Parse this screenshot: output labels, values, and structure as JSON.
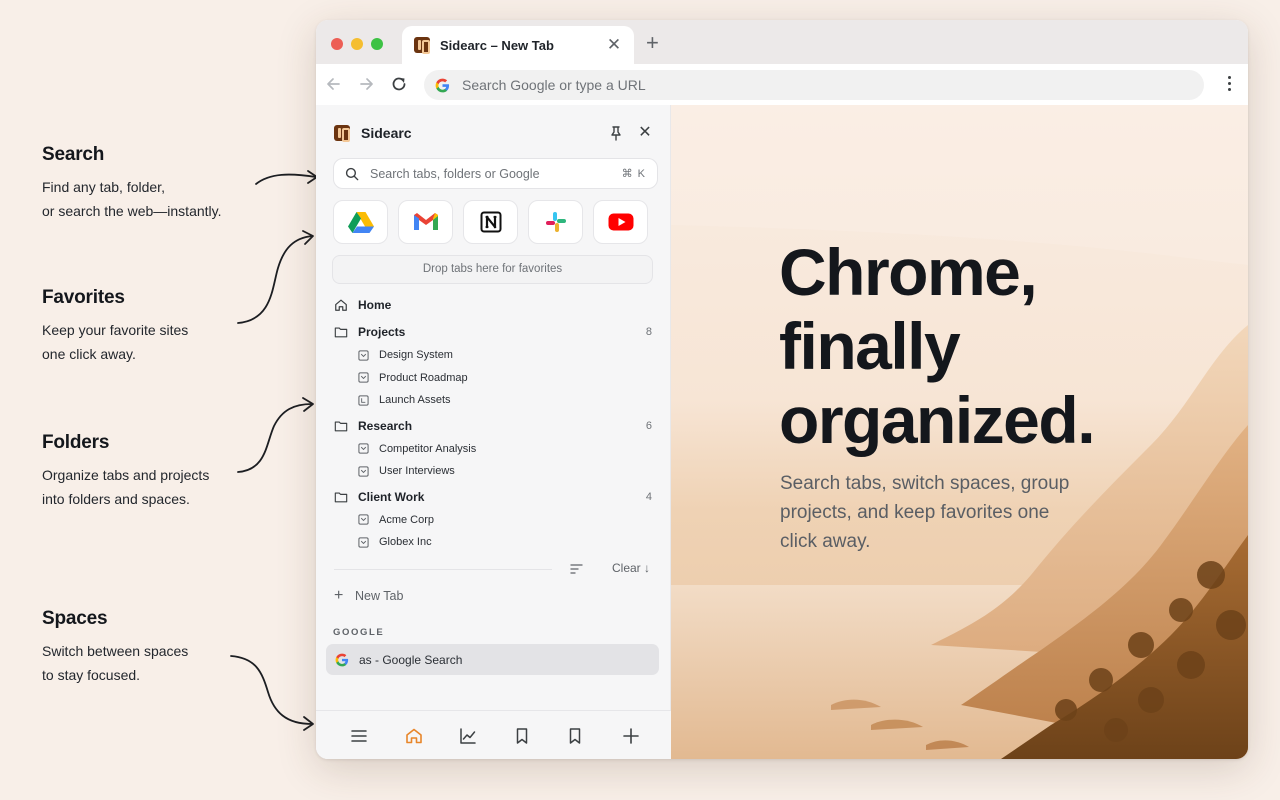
{
  "annotations": [
    {
      "title": "Search",
      "line1": "Find any tab, folder,",
      "line2": "or search the web—instantly."
    },
    {
      "title": "Favorites",
      "line1": "Keep your favorite sites",
      "line2": "one click away."
    },
    {
      "title": "Folders",
      "line1": "Organize tabs and projects",
      "line2": "into folders and spaces."
    },
    {
      "title": "Spaces",
      "line1": "Switch between spaces",
      "line2": "to stay focused."
    }
  ],
  "browser": {
    "tab_title": "Sidearc – New Tab",
    "tab_close": "✕",
    "new_tab_symbol": "+",
    "omnibox_placeholder": "Search Google or type a URL"
  },
  "sidebar": {
    "title": "Sidearc",
    "close_symbol": "✕",
    "search_placeholder": "Search tabs, folders or Google",
    "search_shortcut": "⌘ K",
    "favorites": [
      {
        "name": "Google Drive",
        "icon": "google-drive-icon"
      },
      {
        "name": "Gmail",
        "icon": "gmail-icon"
      },
      {
        "name": "Notion",
        "icon": "notion-icon"
      },
      {
        "name": "Slack",
        "icon": "slack-icon"
      },
      {
        "name": "YouTube",
        "icon": "youtube-icon"
      }
    ],
    "dropzone_text": "Drop tabs here for favorites",
    "home_label": "Home",
    "folders": [
      {
        "label": "Projects",
        "count": "8",
        "children": [
          "Design System",
          "Product Roadmap",
          "Launch Assets"
        ]
      },
      {
        "label": "Research",
        "count": "6",
        "children": [
          "Competitor Analysis",
          "User Interviews"
        ]
      },
      {
        "label": "Client Work",
        "count": "4",
        "children": [
          "Acme Corp",
          "Globex Inc"
        ]
      }
    ],
    "clear_label": "Clear ↓",
    "new_tab_label": "New Tab",
    "new_tab_symbol": "+",
    "space_name": "GOOGLE",
    "active_tab_label": "as - Google Search",
    "bottom_bar": [
      "menu-icon",
      "home-icon",
      "chart-icon",
      "bookmark-icon",
      "bookmark-outline-icon",
      "plus-icon"
    ]
  },
  "content": {
    "headline_1": "Chrome,",
    "headline_2": "finally",
    "headline_3": "organized.",
    "subline": "Search tabs, switch spaces, group projects, and keep favorites one click away."
  },
  "colors": {
    "background": "#f8efe8",
    "accent_home": "#e8862a",
    "text_dark": "#14171c"
  }
}
